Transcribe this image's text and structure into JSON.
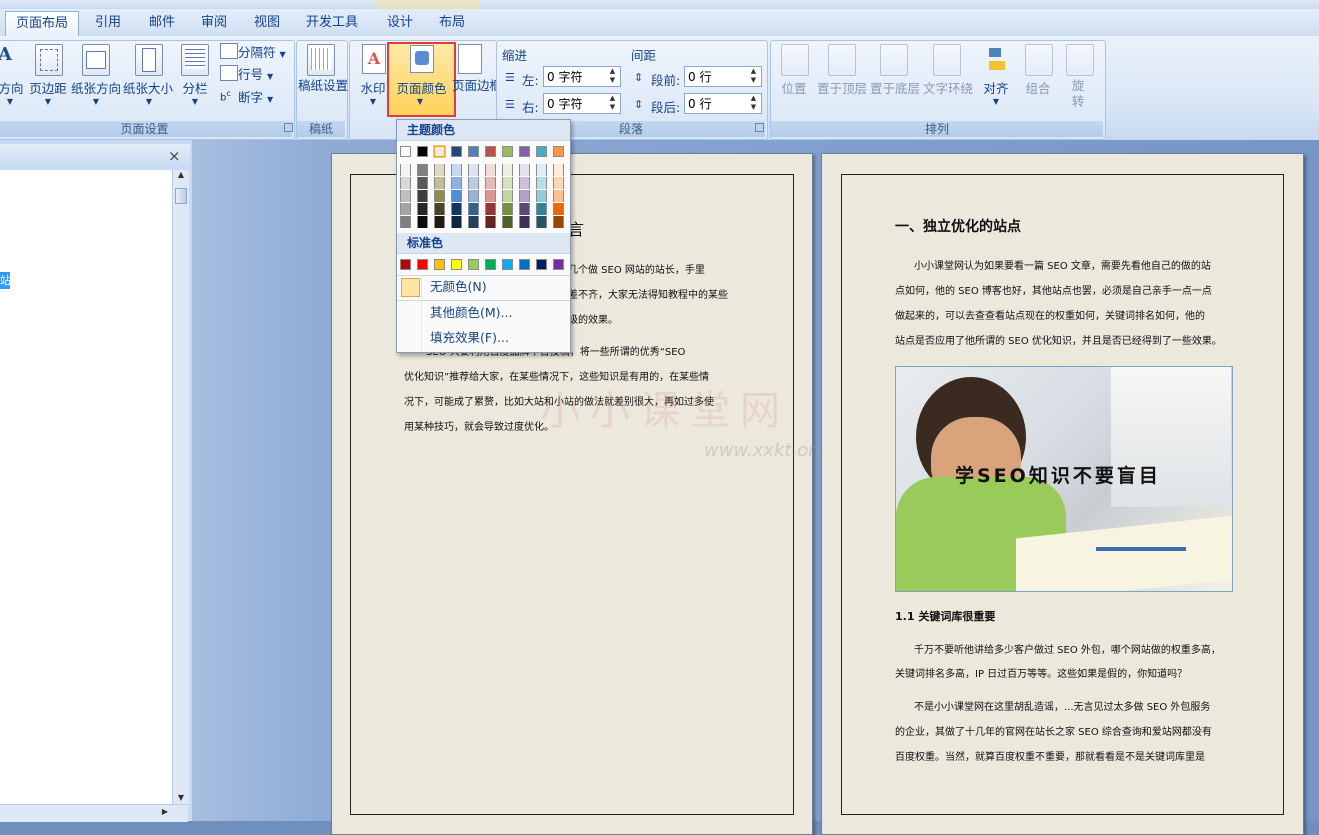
{
  "tabs": [
    "页面布局",
    "引用",
    "邮件",
    "审阅",
    "视图",
    "开发工具",
    "设计",
    "布局"
  ],
  "active_tab": "页面布局",
  "page_setup": {
    "direction": "方向",
    "margins": "页边距",
    "orientation": "纸张方向",
    "size": "纸张大小",
    "columns": "分栏",
    "breaks": "分隔符",
    "line_numbers": "行号",
    "hyphenation": "断字",
    "group_label": "页面设置"
  },
  "manuscript": {
    "button": "稿纸设置",
    "group_label": "稿纸"
  },
  "page_background": {
    "watermark": "水印",
    "page_color": "页面颜色",
    "page_borders": "页面边框"
  },
  "paragraph": {
    "indent_label": "缩进",
    "spacing_label": "间距",
    "left_label": "左:",
    "right_label": "右:",
    "before_label": "段前:",
    "after_label": "段后:",
    "left_value": "0 字符",
    "right_value": "0 字符",
    "before_value": "0 行",
    "after_value": "0 行",
    "group_label": "段落"
  },
  "arrange": {
    "position": "位置",
    "bring_front": "置于顶层",
    "send_back": "置于底层",
    "wrap_text": "文字环绕",
    "align": "对齐",
    "group": "组合",
    "rotate": "旋转",
    "group_label": "排列"
  },
  "nav_pane": {
    "close": "×",
    "selected_fragment": "站"
  },
  "dropdown": {
    "theme_colors_label": "主题颜色",
    "standard_colors_label": "标准色",
    "no_color": "无颜色(N)",
    "more_colors": "其他颜色(M)...",
    "fill_effects": "填充效果(F)...",
    "theme_top_row": [
      "#ffffff",
      "#000000",
      "#eeece1",
      "#1f497d",
      "#4f81bd",
      "#c0504d",
      "#9bbb59",
      "#8064a2",
      "#4bacc6",
      "#f79646"
    ],
    "theme_shades": [
      [
        "#f2f2f2",
        "#7f7f7f",
        "#ddd9c3",
        "#c6d9f0",
        "#dbe5f1",
        "#f2dcdb",
        "#ebf1dd",
        "#e5e0ec",
        "#dbeef3",
        "#fdeada"
      ],
      [
        "#d8d8d8",
        "#595959",
        "#c4bd97",
        "#8db3e2",
        "#b8cce4",
        "#e5b9b7",
        "#d7e3bc",
        "#ccc1d9",
        "#b7dde8",
        "#fbd5b5"
      ],
      [
        "#bfbfbf",
        "#3f3f3f",
        "#938953",
        "#548dd4",
        "#95b3d7",
        "#d99694",
        "#c3d69b",
        "#b2a2c7",
        "#92cddc",
        "#fac08f"
      ],
      [
        "#a5a5a5",
        "#262626",
        "#494429",
        "#17365d",
        "#366092",
        "#953734",
        "#76923c",
        "#5f497a",
        "#31859b",
        "#e36c09"
      ],
      [
        "#7f7f7f",
        "#0c0c0c",
        "#1d1b10",
        "#0f243e",
        "#244061",
        "#632423",
        "#4f6128",
        "#3f3151",
        "#205867",
        "#974806"
      ]
    ],
    "standard": [
      "#c00000",
      "#ff0000",
      "#ffc000",
      "#ffff00",
      "#92d050",
      "#00b050",
      "#00b0f0",
      "#0070c0",
      "#002060",
      "#7030a0"
    ]
  },
  "page1": {
    "title_fragment": "言",
    "lines": [
      "网问过几个做 SEO 网站的站长，手里",
      "差不齐，大家无法得知教程中的某些",
      "级的效果。",
      "SEO 只要利用百度品牌平台投稿，将一些所谓的优秀“SEO",
      "优化知识”推荐给大家，在某些情况下，这些知识是有用的，在某些情",
      "况下，可能成了累赘，比如大站和小站的做法就差别很大，再如过多使",
      "用某种技巧，就会导致过度优化。"
    ],
    "watermark_text": "小小课堂网",
    "watermark_url": "www.xxkt.org"
  },
  "page2": {
    "heading": "一、独立优化的站点",
    "para1": [
      "小小课堂网认为如果要看一篇 SEO 文章，需要先看他自己的做的站",
      "点如何，他的 SEO 博客也好，其他站点也罢，必须是自己亲手一点一点",
      "做起来的，可以去查查看站点现在的权重如何，关键词排名如何，他的",
      "站点是否应用了他所谓的 SEO 优化知识，并且是否已经得到了一些效果。"
    ],
    "image_caption": "学SEO知识不要盲目",
    "subheading": "1.1 关键词库很重要",
    "para2": [
      "千万不要听他讲给多少客户做过 SEO 外包，哪个网站做的权重多高，",
      "关键词排名多高，IP 日过百万等等。这些如果是假的，你知道吗？"
    ],
    "para3": [
      "不是小小课堂网在这里胡乱造谣，...无言见过太多做 SEO 外包服务",
      "的企业，其做了十几年的官网在站长之家 SEO 综合查询和爱站网都没有",
      "百度权重。当然，就算百度权重不重要，那就看看是不是关键词库里是"
    ]
  }
}
